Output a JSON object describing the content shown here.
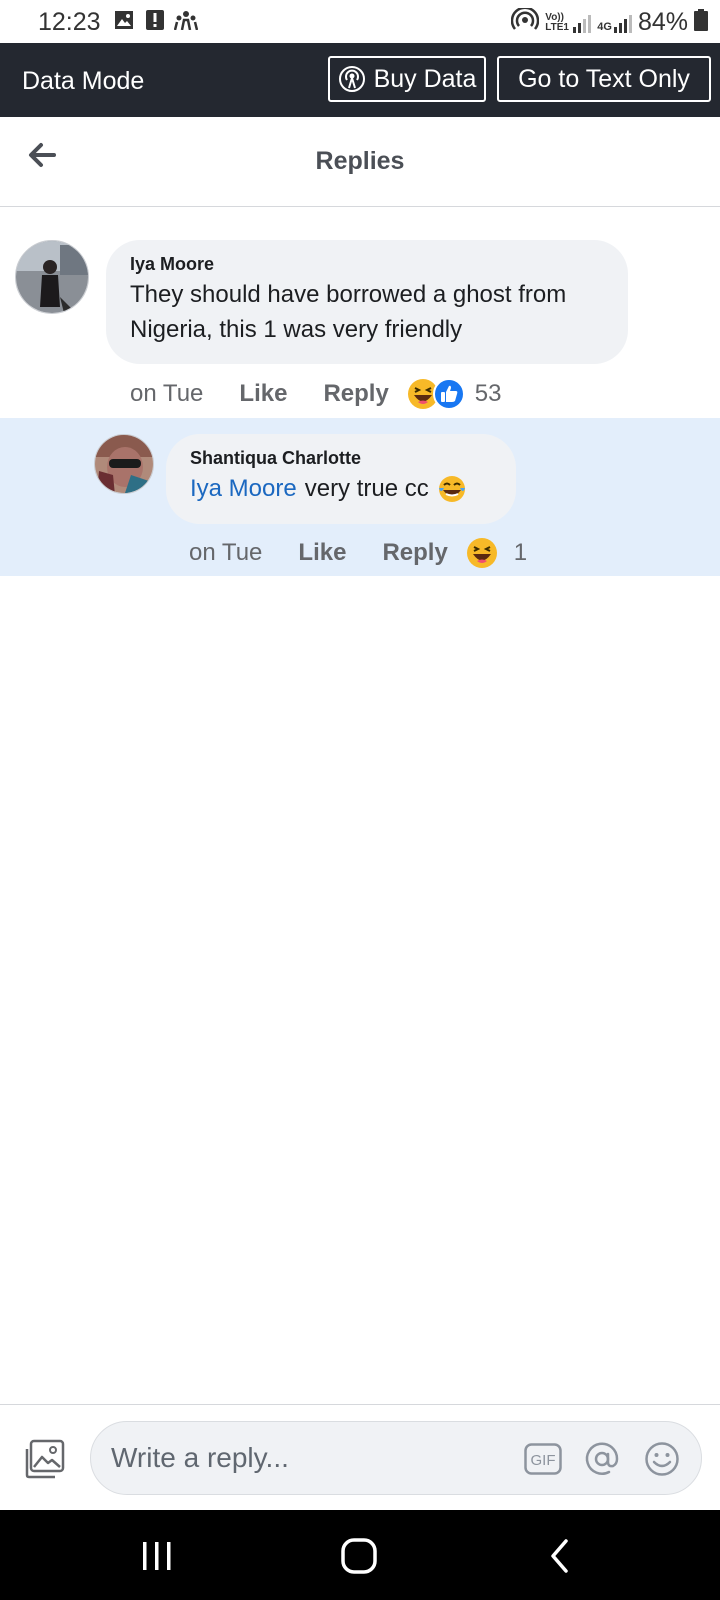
{
  "status_bar": {
    "time": "12:23",
    "battery": "84%",
    "network_volte": "Vo)) LTE1",
    "network_4g": "4G"
  },
  "data_mode_bar": {
    "title": "Data Mode",
    "buy_data_label": "Buy Data",
    "text_only_label": "Go to Text Only"
  },
  "header": {
    "title": "Replies"
  },
  "comment": {
    "author": "Iya Moore",
    "text": "They should have borrowed a ghost from Nigeria, this 1 was very friendly",
    "time": "on Tue",
    "like_label": "Like",
    "reply_label": "Reply",
    "reaction_count": "53",
    "reactions": [
      "haha-icon",
      "like-icon"
    ]
  },
  "reply": {
    "author": "Shantiqua Charlotte",
    "mention": "Iya Moore",
    "text": "very true cc",
    "emoji": "😂",
    "time": "on Tue",
    "like_label": "Like",
    "reply_label": "Reply",
    "reaction_count": "1",
    "reactions": [
      "haha-icon"
    ]
  },
  "composer": {
    "placeholder": "Write a reply...",
    "gif_label": "GIF"
  },
  "colors": {
    "data_bar_bg": "#242830",
    "reply_highlight": "#e3eefb",
    "bubble_bg": "#f0f2f5",
    "mention": "#1b68c0",
    "like_blue": "#1877f2",
    "haha_yellow": "#f7b928"
  }
}
